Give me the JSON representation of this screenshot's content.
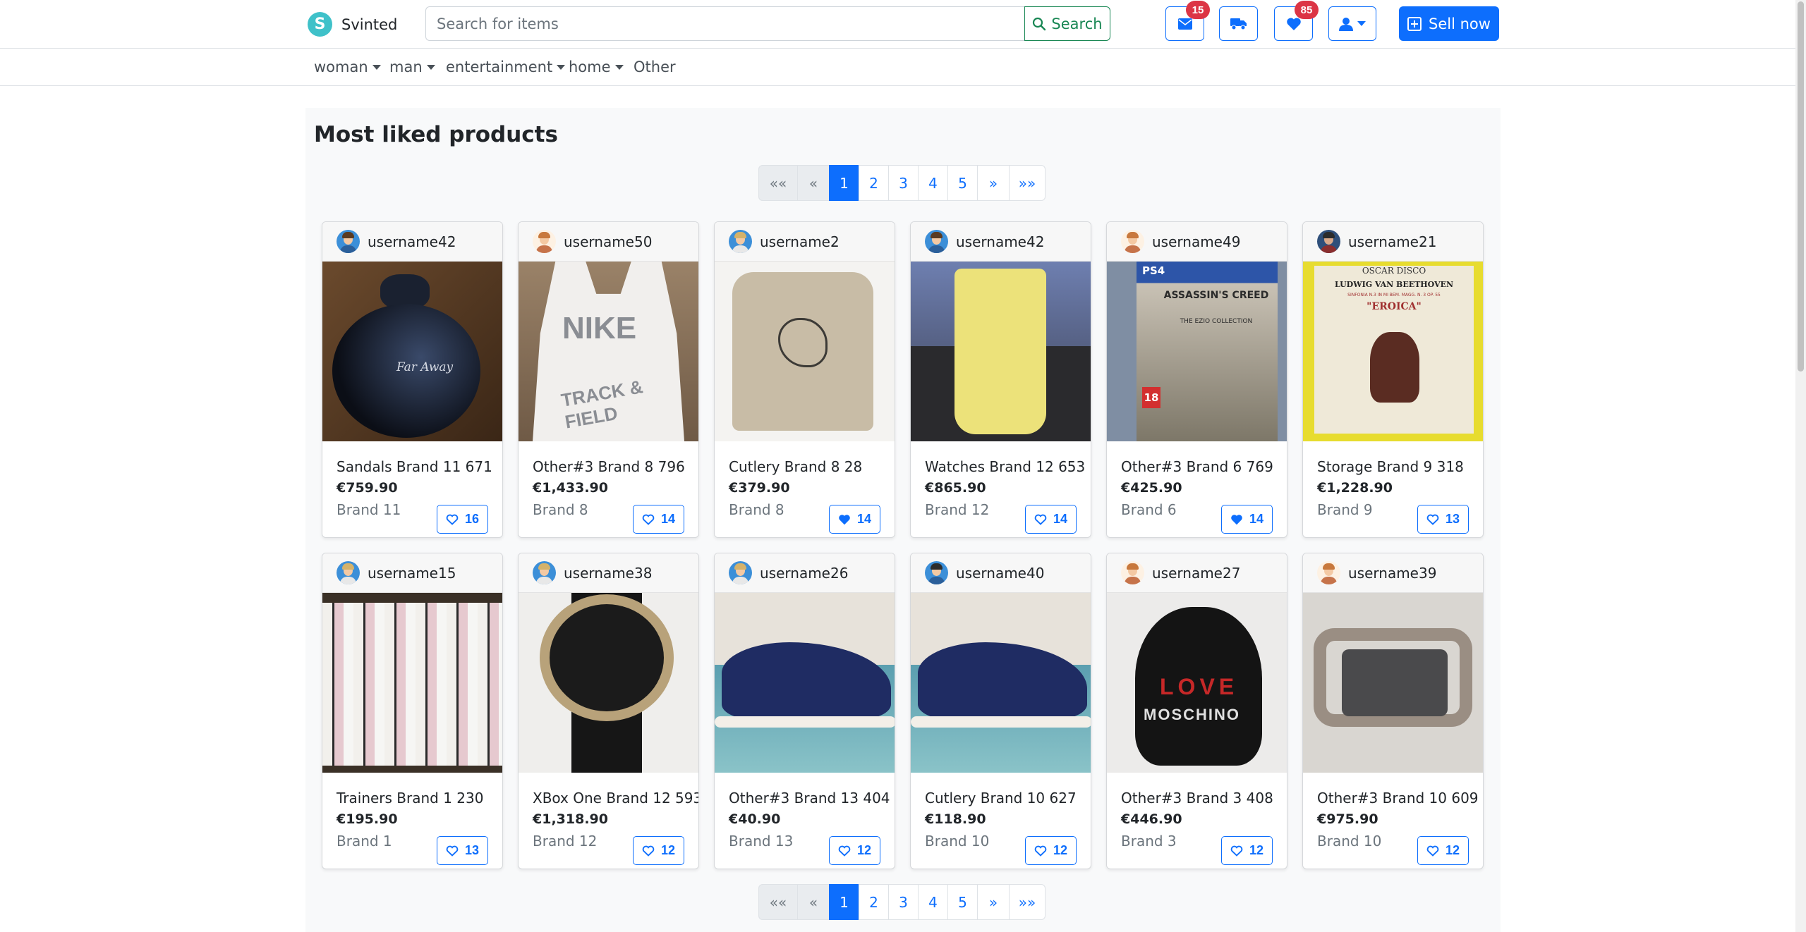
{
  "navbar": {
    "brand_letter": "S",
    "brand_name": "Svinted",
    "search_placeholder": "Search for items",
    "search_button": "Search",
    "messages_badge": "15",
    "favorites_badge": "85",
    "sell_button": "Sell now",
    "icons": [
      "envelope-icon",
      "truck-icon",
      "heart-icon",
      "user-icon",
      "plus-square-icon"
    ]
  },
  "categories": [
    {
      "label": "woman",
      "dropdown": true
    },
    {
      "label": "man",
      "dropdown": true
    },
    {
      "label": "entertainment",
      "dropdown": true
    },
    {
      "label": "home",
      "dropdown": true
    },
    {
      "label": "Other",
      "dropdown": false
    }
  ],
  "main": {
    "title": "Most liked products",
    "pagination": {
      "first": "««",
      "prev": "«",
      "pages": [
        "1",
        "2",
        "3",
        "4",
        "5"
      ],
      "active_page": "1",
      "next": "»",
      "last": "»»"
    }
  },
  "products": [
    {
      "username": "username42",
      "title": "Sandals Brand 11 671",
      "price": "€759.90",
      "brand": "Brand 11",
      "likes": "16",
      "liked": false
    },
    {
      "username": "username50",
      "title": "Other#3 Brand 8 796",
      "price": "€1,433.90",
      "brand": "Brand 8",
      "likes": "14",
      "liked": false
    },
    {
      "username": "username2",
      "title": "Cutlery Brand 8 28",
      "price": "€379.90",
      "brand": "Brand 8",
      "likes": "14",
      "liked": true
    },
    {
      "username": "username42",
      "title": "Watches Brand 12 653",
      "price": "€865.90",
      "brand": "Brand 12",
      "likes": "14",
      "liked": false
    },
    {
      "username": "username49",
      "title": "Other#3 Brand 6 769",
      "price": "€425.90",
      "brand": "Brand 6",
      "likes": "14",
      "liked": true
    },
    {
      "username": "username21",
      "title": "Storage Brand 9 318",
      "price": "€1,228.90",
      "brand": "Brand 9",
      "likes": "13",
      "liked": false
    },
    {
      "username": "username15",
      "title": "Trainers Brand 1 230",
      "price": "€195.90",
      "brand": "Brand 1",
      "likes": "13",
      "liked": false
    },
    {
      "username": "username38",
      "title": "XBox One Brand 12 593",
      "price": "€1,318.90",
      "brand": "Brand 12",
      "likes": "12",
      "liked": false
    },
    {
      "username": "username26",
      "title": "Other#3 Brand 13 404",
      "price": "€40.90",
      "brand": "Brand 13",
      "likes": "12",
      "liked": false
    },
    {
      "username": "username40",
      "title": "Cutlery Brand 10 627",
      "price": "€118.90",
      "brand": "Brand 10",
      "likes": "12",
      "liked": false
    },
    {
      "username": "username27",
      "title": "Other#3 Brand 3 408",
      "price": "€446.90",
      "brand": "Brand 3",
      "likes": "12",
      "liked": false
    },
    {
      "username": "username39",
      "title": "Other#3 Brand 10 609",
      "price": "€975.90",
      "brand": "Brand 10",
      "likes": "12",
      "liked": false
    }
  ],
  "photo_text": {
    "nike_logo": "NIKE",
    "nike_sub": "TRACK & FIELD",
    "game_platform": "PS4",
    "game_title": "ASSASSIN'S CREED",
    "game_sub": "THE EZIO COLLECTION",
    "game_rating": "18",
    "record_label": "OSCAR DISCO",
    "record_artist": "LUDWIG VAN BEETHOVEN",
    "record_sub": "SINFONIA N.3 IN MI BEM. MAGG. N. 3 OP. 55",
    "record_title": "\"EROICA\"",
    "bag_text_top": "LOVE",
    "bag_text_bottom": "MOSCHINO",
    "perfume_text": "Far Away"
  }
}
